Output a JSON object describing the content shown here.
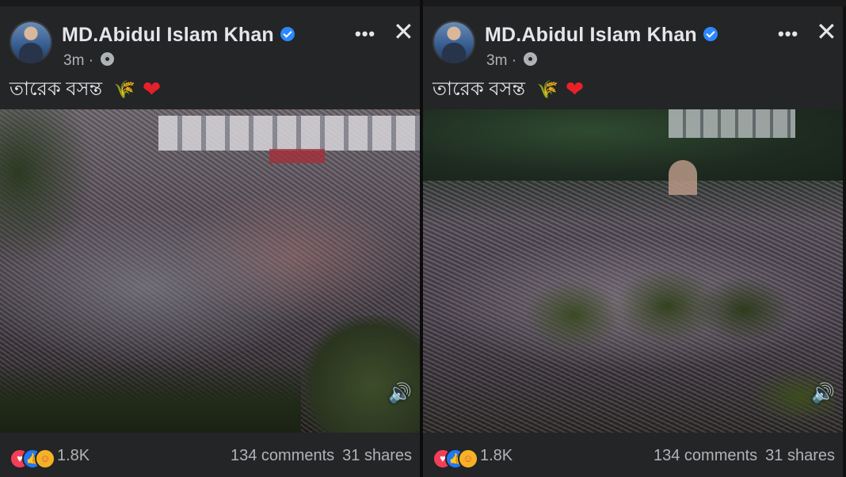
{
  "posts": [
    {
      "author": "MD.Abidul Islam Khan",
      "time": "3m",
      "caption": "তারেক বসন্ত",
      "caption_emojis": [
        "🌾",
        "❤"
      ],
      "reaction_count": "1.8K",
      "comments": "134 comments",
      "shares": "31 shares",
      "icons": [
        "avatar",
        "verified-badge-icon",
        "globe-icon",
        "more-options-icon",
        "close-icon",
        "volume-icon",
        "love-reaction-icon",
        "like-reaction-icon",
        "care-reaction-icon"
      ]
    },
    {
      "author": "MD.Abidul Islam Khan",
      "time": "3m",
      "caption": "তারেক বসন্ত",
      "caption_emojis": [
        "🌾",
        "❤"
      ],
      "reaction_count": "1.8K",
      "comments": "134 comments",
      "shares": "31 shares",
      "icons": [
        "avatar",
        "verified-badge-icon",
        "globe-icon",
        "more-options-icon",
        "close-icon",
        "volume-icon",
        "love-reaction-icon",
        "like-reaction-icon",
        "care-reaction-icon"
      ]
    }
  ],
  "glyphs": {
    "dot": "·",
    "more": "•••",
    "close": "✕",
    "volume": "🔊",
    "love": "♥",
    "like": "👍",
    "care": "☺"
  },
  "colors": {
    "background": "#242526",
    "text_primary": "#e4e6eb",
    "text_secondary": "#b0b3b8",
    "verified": "#2d88ff",
    "love": "#f33e58",
    "like": "#2078f4",
    "care": "#f7b125"
  }
}
